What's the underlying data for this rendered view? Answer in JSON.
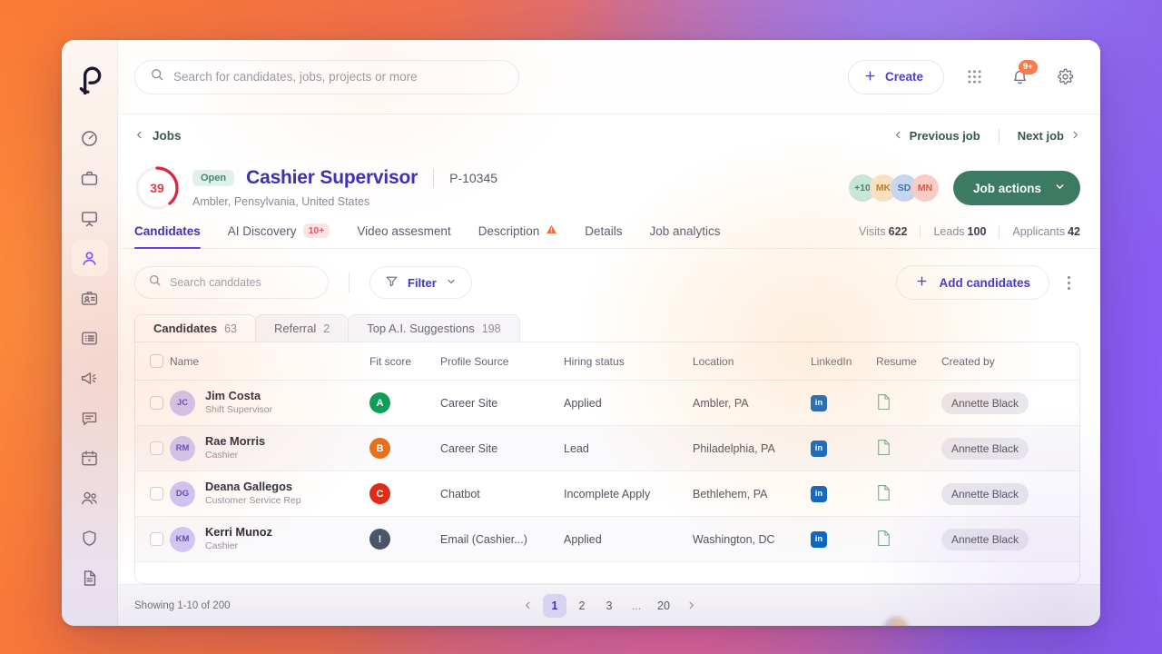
{
  "colors": {
    "brand_purple": "#3b2fb5",
    "accent_violet": "#5b3ff0",
    "job_actions_green": "#3d7a64",
    "status_open_bg": "#dff1ea",
    "badge_orange": "#fb7a4a",
    "score_red": "#e03a4e",
    "linkedin_blue": "#0a66c2"
  },
  "sidebar": {
    "logo": "p-logo",
    "items": [
      {
        "icon": "dashboard-gauge-icon",
        "name": "dashboard",
        "active": false
      },
      {
        "icon": "briefcase-icon",
        "name": "jobs",
        "active": false
      },
      {
        "icon": "monitor-icon",
        "name": "campaigns",
        "active": false
      },
      {
        "icon": "person-icon",
        "name": "candidates",
        "active": true
      },
      {
        "icon": "id-badge-icon",
        "name": "employees",
        "active": false
      },
      {
        "icon": "list-icon",
        "name": "tasks",
        "active": false
      },
      {
        "icon": "megaphone-icon",
        "name": "announcements",
        "active": false
      },
      {
        "icon": "chat-icon",
        "name": "messages",
        "active": false
      },
      {
        "icon": "calendar-icon",
        "name": "calendar",
        "active": false
      },
      {
        "icon": "people-icon",
        "name": "teams",
        "active": false
      },
      {
        "icon": "shield-icon",
        "name": "compliance",
        "active": false
      },
      {
        "icon": "document-icon",
        "name": "reports",
        "active": false
      }
    ]
  },
  "topbar": {
    "search_placeholder": "Search for candidates, jobs, projects or more",
    "search_value": "",
    "create_label": "Create",
    "notification_badge": "9+"
  },
  "breadcrumb": {
    "back_label": "Jobs",
    "previous_job": "Previous job",
    "next_job": "Next job"
  },
  "job": {
    "score": "39",
    "score_percent": 39,
    "status": "Open",
    "title": "Cashier Supervisor",
    "id": "P-10345",
    "location": "Ambler, Pensylvania, United States",
    "actions_label": "Job actions",
    "avatars": [
      {
        "label": "+10",
        "bg": "#c5e8e0",
        "fg": "#4c7d72"
      },
      {
        "label": "MK",
        "bg": "#fbe3c2",
        "fg": "#b07e38"
      },
      {
        "label": "SD",
        "bg": "#c5d8f5",
        "fg": "#3f6cb5"
      },
      {
        "label": "MN",
        "bg": "#f9cdc6",
        "fg": "#c85a4c"
      }
    ]
  },
  "tabs": [
    {
      "label": "Candidates",
      "pill": "",
      "active": true,
      "warn": false
    },
    {
      "label": "AI Discovery",
      "pill": "10+",
      "active": false,
      "warn": false
    },
    {
      "label": "Video assesment",
      "pill": "",
      "active": false,
      "warn": false
    },
    {
      "label": "Description",
      "pill": "",
      "active": false,
      "warn": true
    },
    {
      "label": "Details",
      "pill": "",
      "active": false,
      "warn": false
    },
    {
      "label": "Job analytics",
      "pill": "",
      "active": false,
      "warn": false
    }
  ],
  "metrics": [
    {
      "label": "Visits",
      "value": "622"
    },
    {
      "label": "Leads",
      "value": "100"
    },
    {
      "label": "Applicants",
      "value": "42"
    }
  ],
  "toolbar": {
    "search_placeholder": "Search canddates",
    "search_value": "",
    "filter_label": "Filter",
    "add_candidates_label": "Add candidates"
  },
  "subtabs": [
    {
      "label": "Candidates",
      "count": "63",
      "active": true
    },
    {
      "label": "Referral",
      "count": "2",
      "active": false
    },
    {
      "label": "Top A.I. Suggestions",
      "count": "198",
      "active": false
    }
  ],
  "table": {
    "columns": [
      "Name",
      "Fit score",
      "Profile Source",
      "Hiring status",
      "Location",
      "LinkedIn",
      "Resume",
      "Created by"
    ],
    "rows": [
      {
        "initials": "JC",
        "name": "Jim Costa",
        "role": "Shift Supervisor",
        "fit": "A",
        "fit_color": "#0f9d58",
        "source": "Career Site",
        "status": "Applied",
        "location": "Ambler, PA",
        "linkedin": "in",
        "resume": "resume-icon",
        "created_by": "Annette Black"
      },
      {
        "initials": "RM",
        "name": "Rae Morris",
        "role": "Cashier",
        "fit": "B",
        "fit_color": "#e8701a",
        "source": "Career Site",
        "status": "Lead",
        "location": "Philadelphia, PA",
        "linkedin": "in",
        "resume": "resume-icon",
        "created_by": "Annette Black"
      },
      {
        "initials": "DG",
        "name": "Deana Gallegos",
        "role": "Customer Service Rep",
        "fit": "C",
        "fit_color": "#e02b16",
        "source": "Chatbot",
        "status": "Incomplete Apply",
        "location": "Bethlehem, PA",
        "linkedin": "in",
        "resume": "resume-icon",
        "created_by": "Annette Black"
      },
      {
        "initials": "KM",
        "name": "Kerri Munoz",
        "role": "Cashier",
        "fit": "!",
        "fit_color": "#4a5568",
        "source": "Email (Cashier...)",
        "status": "Applied",
        "location": "Washington, DC",
        "linkedin": "in",
        "resume": "resume-icon",
        "created_by": "Annette Black"
      }
    ]
  },
  "footer": {
    "showing": "Showing 1-10 of 200",
    "pages": [
      "1",
      "2",
      "3",
      "...",
      "20"
    ],
    "current_page": "1"
  }
}
